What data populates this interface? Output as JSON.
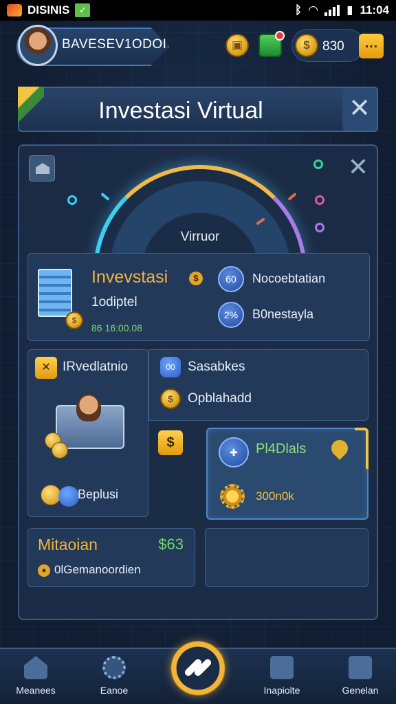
{
  "status_bar": {
    "app_name": "DISINIS",
    "time": "11:04"
  },
  "profile": {
    "name": "BAVESEV1ODOI"
  },
  "resources": {
    "coin_value": "830"
  },
  "title_bar": {
    "title": "Investasi Virtual"
  },
  "gauge": {
    "label": "Virruor"
  },
  "card_invest": {
    "title": "Invevstasi",
    "subtitle": "1odiptel",
    "amount": "86 16:00.08",
    "rows": [
      {
        "icon_text": "60",
        "label": "Nocoebtatian"
      },
      {
        "icon_text": "2%",
        "label": "B0nestayla"
      }
    ]
  },
  "card_revenue": {
    "title": "IRvedlatnio",
    "footer": "Beplusi"
  },
  "card_sales": {
    "row1": "Sasabkes",
    "row2": "Opblahadd"
  },
  "card_plans": {
    "title": "Pl4Dlals",
    "value": "300n0k"
  },
  "card_mission": {
    "title": "Mitaoian",
    "amount": "$63",
    "subtitle": "0lGemanoordien"
  },
  "nav": {
    "items": [
      {
        "label": "Meanees",
        "icon": "home-icon"
      },
      {
        "label": "Eanoe",
        "icon": "gear-icon"
      },
      {
        "label": "Inapiolte",
        "icon": "lock-icon"
      },
      {
        "label": "Genelan",
        "icon": "clipboard-icon"
      }
    ]
  },
  "colors": {
    "accent_gold": "#f3b43a",
    "accent_green": "#6fd76a",
    "panel": "#22395a",
    "background": "#13223a"
  }
}
